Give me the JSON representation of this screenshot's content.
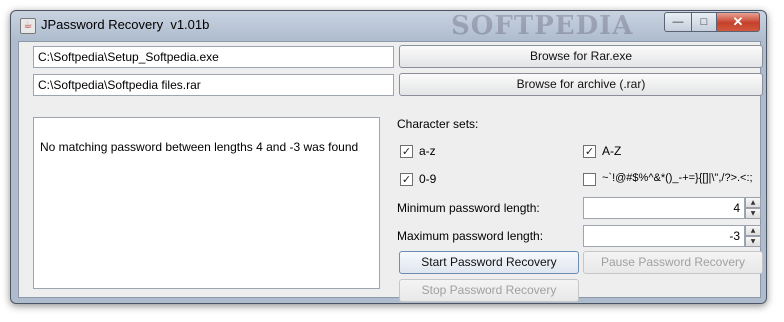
{
  "window": {
    "title": "JPassword Recovery  v1.01b",
    "watermark": "SOFTPEDIA",
    "controls": {
      "minimize": "—",
      "maximize": "□",
      "close": "✕"
    }
  },
  "paths": {
    "rar_exe": "C:\\Softpedia\\Setup_Softpedia.exe",
    "archive": "C:\\Softpedia\\Softpedia files.rar"
  },
  "buttons": {
    "browse_rar": "Browse for Rar.exe",
    "browse_archive": "Browse for archive (.rar)",
    "start": "Start Password Recovery",
    "pause": "Pause Password Recovery",
    "stop": "Stop Password Recovery"
  },
  "output": {
    "message": "No matching password between lengths 4 and -3 was found"
  },
  "charsets": {
    "heading": "Character sets:",
    "items": [
      {
        "label": "a-z",
        "checked": true
      },
      {
        "label": "A-Z",
        "checked": true
      },
      {
        "label": "0-9",
        "checked": true
      },
      {
        "label": "~`!@#$%^&*()_-+=}{[]|\\\",/?>.<:;",
        "checked": false
      }
    ]
  },
  "lengths": {
    "min_label": "Minimum password length:",
    "min_value": "4",
    "max_label": "Maximum password length:",
    "max_value": "-3"
  }
}
